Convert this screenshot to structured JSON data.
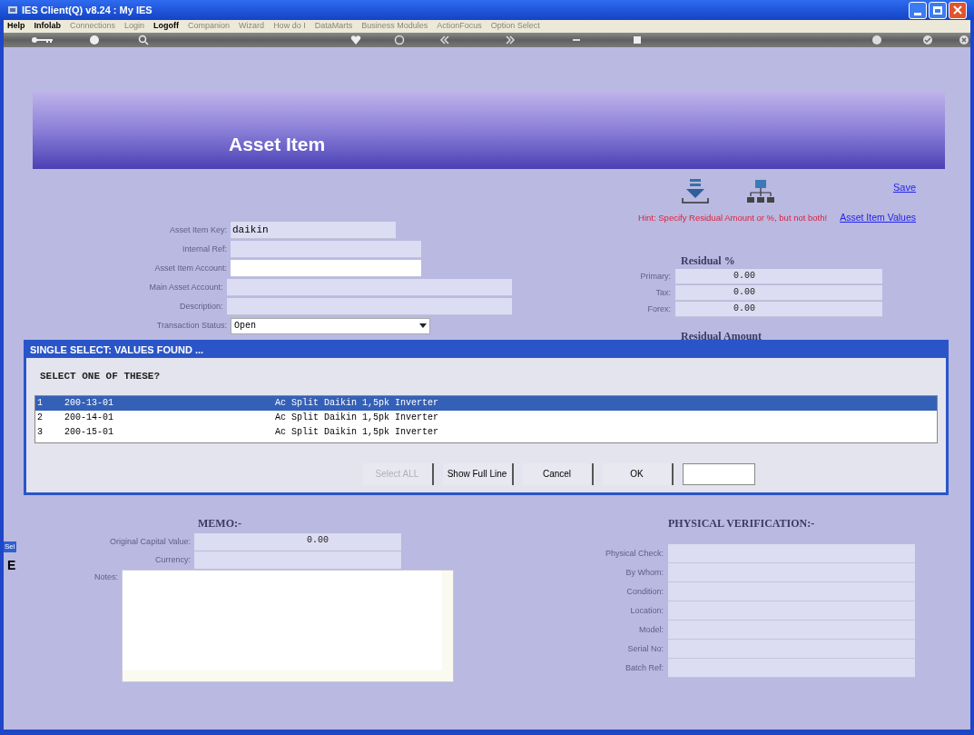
{
  "window": {
    "title": "IES Client(Q) v8.24 : My IES"
  },
  "menu": [
    {
      "label": "Help",
      "disabled": false
    },
    {
      "label": "Infolab",
      "disabled": false
    },
    {
      "label": "Connections",
      "disabled": true
    },
    {
      "label": "Login",
      "disabled": true
    },
    {
      "label": "Logoff",
      "disabled": false
    },
    {
      "label": "Companion",
      "disabled": true
    },
    {
      "label": "Wizard",
      "disabled": true
    },
    {
      "label": "How do I",
      "disabled": true
    },
    {
      "label": "DataMarts",
      "disabled": true
    },
    {
      "label": "Business Modules",
      "disabled": true
    },
    {
      "label": "ActionFocus",
      "disabled": true
    },
    {
      "label": "Option Select",
      "disabled": true
    }
  ],
  "page": {
    "title": "Asset Item",
    "save": "Save",
    "values_link": "Asset Item Values",
    "hint": "Hint: Specify Residual Amount or %, but not both!"
  },
  "form": [
    {
      "label": "Asset Item Key:",
      "value": "daikin",
      "kind": "text",
      "editable": false
    },
    {
      "label": "Internal Ref:",
      "kind": "text",
      "editable": false
    },
    {
      "label": "Asset Item Account:",
      "kind": "text",
      "editable": true
    },
    {
      "label": "Main Asset Account:",
      "kind": "text",
      "editable": false
    },
    {
      "label": "Description:",
      "kind": "text",
      "editable": false
    },
    {
      "label": "Transaction Status:",
      "value": "Open",
      "kind": "select",
      "editable": true
    }
  ],
  "residual_percent": {
    "heading": "Residual %",
    "fields": [
      {
        "label": "Primary:",
        "value": "0.00"
      },
      {
        "label": "Tax:",
        "value": "0.00"
      },
      {
        "label": "Forex:",
        "value": "0.00"
      }
    ]
  },
  "residual_amount": {
    "heading": "Residual Amount"
  },
  "dialog": {
    "title": "SINGLE SELECT: VALUES FOUND ...",
    "prompt": "SELECT ONE OF THESE?",
    "rows": [
      {
        "number": "1",
        "code": "200-13-01",
        "description": "Ac Split Daikin 1,5pk Inverter",
        "selected": true
      },
      {
        "number": "2",
        "code": "200-14-01",
        "description": "Ac Split Daikin 1,5pk Inverter",
        "selected": false
      },
      {
        "number": "3",
        "code": "200-15-01",
        "description": "Ac Split Daikin 1,5pk Inverter",
        "selected": false
      }
    ],
    "buttons": [
      {
        "label": "Select ALL",
        "disabled": true
      },
      {
        "label": "Show Full Line",
        "disabled": false
      },
      {
        "label": "Cancel",
        "disabled": false
      },
      {
        "label": "OK",
        "disabled": false
      }
    ]
  },
  "memo": {
    "heading": "MEMO:-",
    "fields": [
      {
        "label": "Original Capital Value:",
        "value": "0.00"
      },
      {
        "label": "Currency:"
      }
    ],
    "notes_label": "Notes:"
  },
  "physical": {
    "heading": "PHYSICAL VERIFICATION:-",
    "fields": [
      {
        "label": "Physical Check:"
      },
      {
        "label": "By Whom:"
      },
      {
        "label": "Condition:"
      },
      {
        "label": "Location:"
      },
      {
        "label": "Model:"
      },
      {
        "label": "Serial No:"
      },
      {
        "label": "Batch Ref:"
      }
    ]
  },
  "side_tab": {
    "label": "Sel",
    "letter": "E"
  }
}
